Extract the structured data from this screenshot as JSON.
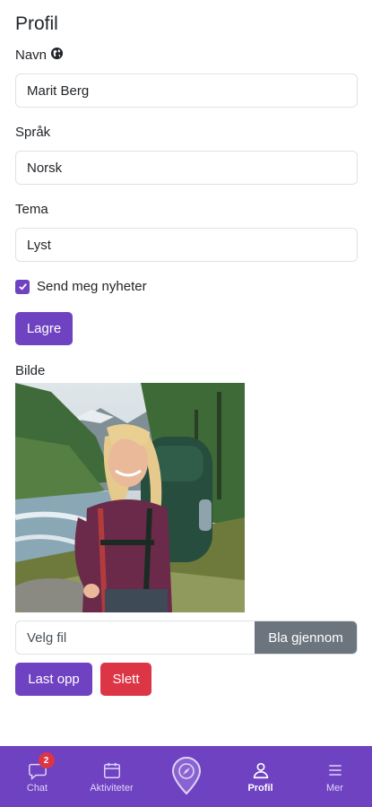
{
  "page": {
    "title": "Profil"
  },
  "form": {
    "name_label": "Navn",
    "name_value": "Marit Berg",
    "language_label": "Språk",
    "language_value": "Norsk",
    "theme_label": "Tema",
    "theme_value": "Lyst",
    "newsletter_label": "Send meg nyheter",
    "newsletter_checked": true,
    "save_label": "Lagre"
  },
  "picture": {
    "label": "Bilde",
    "file_placeholder": "Velg fil",
    "browse_label": "Bla gjennom",
    "upload_label": "Last opp",
    "delete_label": "Slett"
  },
  "nav": {
    "items": [
      {
        "label": "Chat",
        "icon": "chat-icon",
        "badge": "2"
      },
      {
        "label": "Aktiviteter",
        "icon": "calendar-icon"
      },
      {
        "label": "",
        "icon": "compass-pin-icon"
      },
      {
        "label": "Profil",
        "icon": "person-icon",
        "active": true
      },
      {
        "label": "Mer",
        "icon": "menu-icon"
      }
    ]
  },
  "colors": {
    "accent": "#6f42c1",
    "danger": "#dc3545",
    "secondary": "#6c757d"
  }
}
